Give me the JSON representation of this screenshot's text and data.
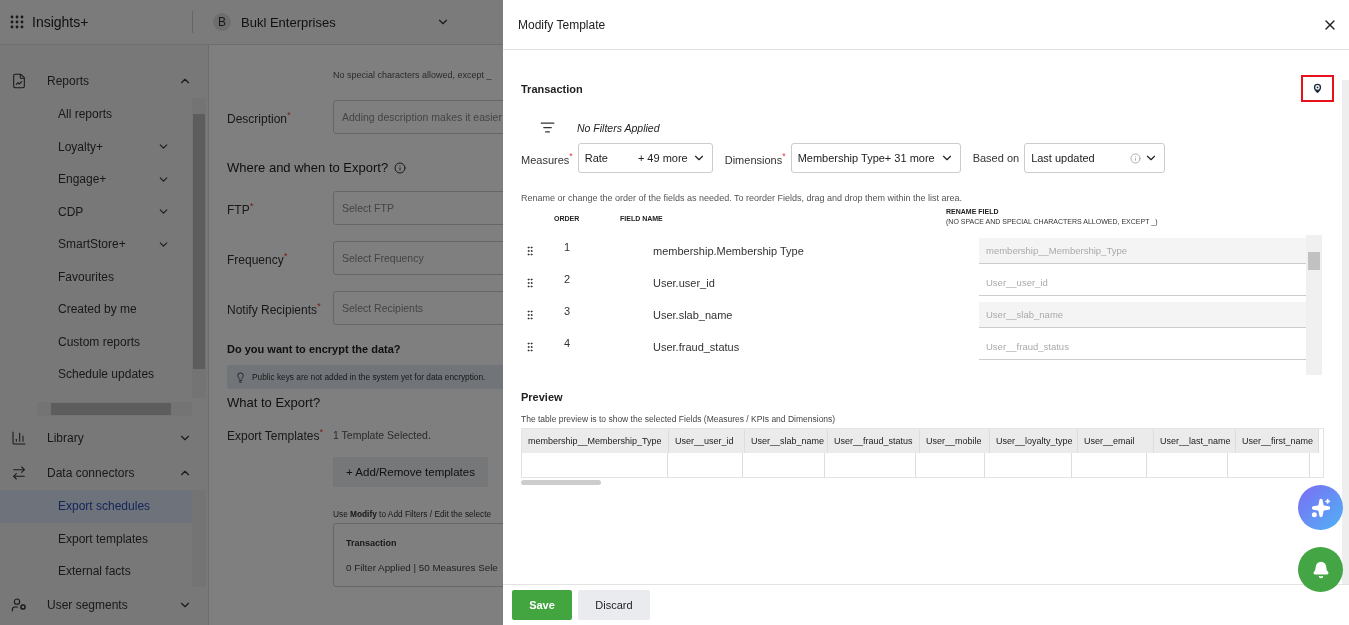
{
  "app": {
    "title": "Insights+",
    "org_initial": "B",
    "org_name": "Bukl Enterprises"
  },
  "sidebar": {
    "sections": [
      {
        "label": "Reports",
        "expanded": true,
        "children": [
          {
            "label": "All reports",
            "kind": "link",
            "selected": false
          },
          {
            "label": "Loyalty+",
            "kind": "group",
            "selected": false
          },
          {
            "label": "Engage+",
            "kind": "group",
            "selected": false
          },
          {
            "label": "CDP",
            "kind": "group",
            "selected": false
          },
          {
            "label": "SmartStore+",
            "kind": "group",
            "selected": false
          },
          {
            "label": "Favourites",
            "kind": "link",
            "selected": false
          },
          {
            "label": "Created by me",
            "kind": "link",
            "selected": false
          },
          {
            "label": "Custom reports",
            "kind": "link",
            "selected": false
          },
          {
            "label": "Schedule updates",
            "kind": "link",
            "selected": false
          }
        ]
      },
      {
        "label": "Library",
        "expanded": false
      },
      {
        "label": "Data connectors",
        "expanded": true,
        "children": [
          {
            "label": "Export schedules",
            "kind": "link",
            "selected": true
          },
          {
            "label": "Export templates",
            "kind": "link",
            "selected": false
          },
          {
            "label": "External facts",
            "kind": "link",
            "selected": false
          }
        ]
      },
      {
        "label": "User segments",
        "expanded": false
      }
    ]
  },
  "form": {
    "name_hint": "No special characters allowed, except _",
    "description": {
      "label": "Description$^{*}$",
      "placeholder": "Adding description makes it easier"
    },
    "export_heading": "Where and when to Export?",
    "fields": [
      {
        "label": "FTP$^{*}$",
        "placeholder": "Select FTP"
      },
      {
        "label": "Frequency$^{*}$",
        "placeholder": "Select Frequency"
      },
      {
        "label": "Notify Recipients$^{*}$",
        "placeholder": "Select Recipients"
      }
    ],
    "encrypt_heading": "Do you want to encrypt the data?",
    "encrypt_note": "Public keys are not added in the system yet for data encryption.",
    "what_heading": "What to Export?",
    "templates": {
      "label": "Export Templates$^{*}$",
      "value": "1 Template Selected.",
      "button": "+ Add/Remove templates",
      "modify_hint": "Use **Modify** to Add Filters / Edit the selecte",
      "card_title": "Transaction",
      "card_summary": "0 Filter Applied | 50 Measures Sele"
    }
  },
  "drawer": {
    "title": "Modify Template",
    "section": "Transaction",
    "pin_highlighted": true,
    "filter_status": "No Filters Applied",
    "selectors": [
      {
        "label": "Measures$^{*}$",
        "value": "Rate",
        "extra": "+ 49 more",
        "info": false
      },
      {
        "label": "Dimensions$^{*}$",
        "value": "Membership Type+ 31 more",
        "info": false
      },
      {
        "label": "Based on",
        "value": "Last updated",
        "info": true
      }
    ],
    "instructions": "Rename or change the order of the fields as needed. To reorder Fields, drag and drop them within the list area.",
    "columns": {
      "order": "ORDER",
      "field": "FIELD NAME",
      "rename": "RENAME FIELD",
      "rename_note": "(NO SPACE AND SPECIAL CHARACTERS ALLOWED, EXCEPT _)"
    },
    "fields": [
      {
        "order": "1",
        "name": "membership.Membership Type",
        "placeholder": "membership__Membership_Type"
      },
      {
        "order": "2",
        "name": "User.user_id",
        "placeholder": "User__user_id"
      },
      {
        "order": "3",
        "name": "User.slab_name",
        "placeholder": "User__slab_name"
      },
      {
        "order": "4",
        "name": "User.fraud_status",
        "placeholder": "User__fraud_status"
      }
    ],
    "preview": {
      "title": "Preview",
      "note": "The table preview is to show the selected Fields (Measures / KPIs and Dimensions)",
      "columns": [
        "membership__Membership_Type",
        "User__user_id",
        "User__slab_name",
        "User__fraud_status",
        "User__mobile",
        "User__loyalty_type",
        "User__email",
        "User__last_name",
        "User__first_name"
      ]
    },
    "buttons": {
      "save": "Save",
      "discard": "Discard"
    }
  }
}
